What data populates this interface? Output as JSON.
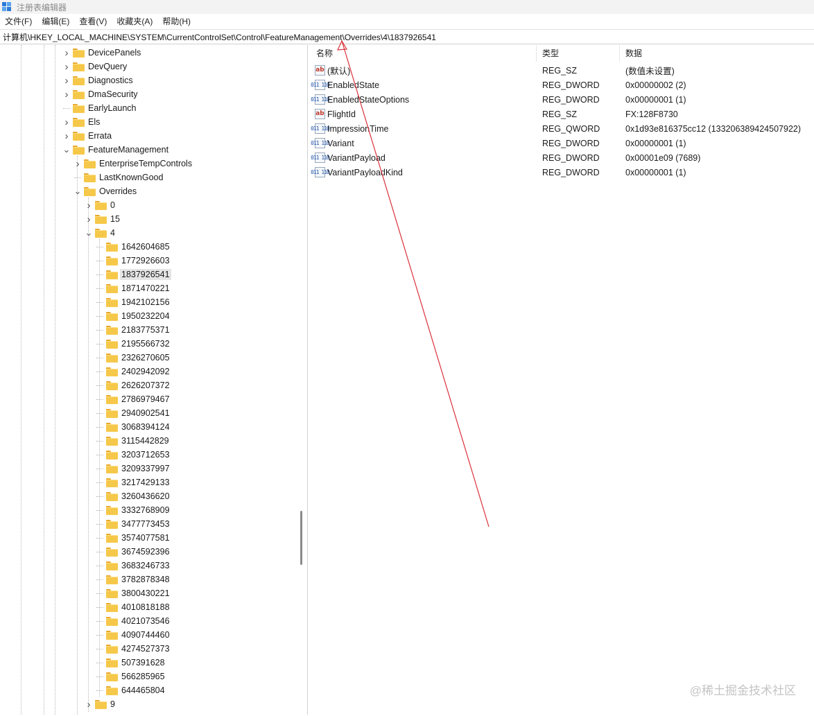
{
  "window": {
    "title": "注册表编辑器"
  },
  "menu": [
    "文件(F)",
    "编辑(E)",
    "查看(V)",
    "收藏夹(A)",
    "帮助(H)"
  ],
  "address": "计算机\\HKEY_LOCAL_MACHINE\\SYSTEM\\CurrentControlSet\\Control\\FeatureManagement\\Overrides\\4\\1837926541",
  "tree": [
    {
      "label": "DevicePanels",
      "level": 0,
      "expander": "collapsed"
    },
    {
      "label": "DevQuery",
      "level": 0,
      "expander": "collapsed"
    },
    {
      "label": "Diagnostics",
      "level": 0,
      "expander": "collapsed"
    },
    {
      "label": "DmaSecurity",
      "level": 0,
      "expander": "collapsed"
    },
    {
      "label": "EarlyLaunch",
      "level": 0,
      "expander": "none"
    },
    {
      "label": "Els",
      "level": 0,
      "expander": "collapsed"
    },
    {
      "label": "Errata",
      "level": 0,
      "expander": "collapsed"
    },
    {
      "label": "FeatureManagement",
      "level": 0,
      "expander": "expanded"
    },
    {
      "label": "EnterpriseTempControls",
      "level": 1,
      "expander": "collapsed"
    },
    {
      "label": "LastKnownGood",
      "level": 1,
      "expander": "none"
    },
    {
      "label": "Overrides",
      "level": 1,
      "expander": "expanded"
    },
    {
      "label": "0",
      "level": 2,
      "expander": "collapsed"
    },
    {
      "label": "15",
      "level": 2,
      "expander": "collapsed"
    },
    {
      "label": "4",
      "level": 2,
      "expander": "expanded"
    },
    {
      "label": "1642604685",
      "level": 3,
      "expander": "none"
    },
    {
      "label": "1772926603",
      "level": 3,
      "expander": "none"
    },
    {
      "label": "1837926541",
      "level": 3,
      "expander": "none",
      "selected": true
    },
    {
      "label": "1871470221",
      "level": 3,
      "expander": "none"
    },
    {
      "label": "1942102156",
      "level": 3,
      "expander": "none"
    },
    {
      "label": "1950232204",
      "level": 3,
      "expander": "none"
    },
    {
      "label": "2183775371",
      "level": 3,
      "expander": "none"
    },
    {
      "label": "2195566732",
      "level": 3,
      "expander": "none"
    },
    {
      "label": "2326270605",
      "level": 3,
      "expander": "none"
    },
    {
      "label": "2402942092",
      "level": 3,
      "expander": "none"
    },
    {
      "label": "2626207372",
      "level": 3,
      "expander": "none"
    },
    {
      "label": "2786979467",
      "level": 3,
      "expander": "none"
    },
    {
      "label": "2940902541",
      "level": 3,
      "expander": "none"
    },
    {
      "label": "3068394124",
      "level": 3,
      "expander": "none"
    },
    {
      "label": "3115442829",
      "level": 3,
      "expander": "none"
    },
    {
      "label": "3203712653",
      "level": 3,
      "expander": "none"
    },
    {
      "label": "3209337997",
      "level": 3,
      "expander": "none"
    },
    {
      "label": "3217429133",
      "level": 3,
      "expander": "none"
    },
    {
      "label": "3260436620",
      "level": 3,
      "expander": "none"
    },
    {
      "label": "3332768909",
      "level": 3,
      "expander": "none"
    },
    {
      "label": "3477773453",
      "level": 3,
      "expander": "none"
    },
    {
      "label": "3574077581",
      "level": 3,
      "expander": "none"
    },
    {
      "label": "3674592396",
      "level": 3,
      "expander": "none"
    },
    {
      "label": "3683246733",
      "level": 3,
      "expander": "none"
    },
    {
      "label": "3782878348",
      "level": 3,
      "expander": "none"
    },
    {
      "label": "3800430221",
      "level": 3,
      "expander": "none"
    },
    {
      "label": "4010818188",
      "level": 3,
      "expander": "none"
    },
    {
      "label": "4021073546",
      "level": 3,
      "expander": "none"
    },
    {
      "label": "4090744460",
      "level": 3,
      "expander": "none"
    },
    {
      "label": "4274527373",
      "level": 3,
      "expander": "none"
    },
    {
      "label": "507391628",
      "level": 3,
      "expander": "none"
    },
    {
      "label": "566285965",
      "level": 3,
      "expander": "none"
    },
    {
      "label": "644465804",
      "level": 3,
      "expander": "none"
    },
    {
      "label": "9",
      "level": 2,
      "expander": "collapsed"
    }
  ],
  "list": {
    "headers": {
      "name": "名称",
      "type": "类型",
      "data": "数据"
    },
    "rows": [
      {
        "icon": "string-value-icon",
        "kind": "sz",
        "name": "(默认)",
        "type": "REG_SZ",
        "data": "(数值未设置)"
      },
      {
        "icon": "binary-value-icon",
        "kind": "bin",
        "name": "EnabledState",
        "type": "REG_DWORD",
        "data": "0x00000002 (2)"
      },
      {
        "icon": "binary-value-icon",
        "kind": "bin",
        "name": "EnabledStateOptions",
        "type": "REG_DWORD",
        "data": "0x00000001 (1)"
      },
      {
        "icon": "string-value-icon",
        "kind": "sz",
        "name": "FlightId",
        "type": "REG_SZ",
        "data": "FX:128F8730"
      },
      {
        "icon": "binary-value-icon",
        "kind": "bin",
        "name": "ImpressionTime",
        "type": "REG_QWORD",
        "data": "0x1d93e816375cc12 (133206389424507922)"
      },
      {
        "icon": "binary-value-icon",
        "kind": "bin",
        "name": "Variant",
        "type": "REG_DWORD",
        "data": "0x00000001 (1)"
      },
      {
        "icon": "binary-value-icon",
        "kind": "bin",
        "name": "VariantPayload",
        "type": "REG_DWORD",
        "data": "0x00001e09 (7689)"
      },
      {
        "icon": "binary-value-icon",
        "kind": "bin",
        "name": "VariantPayloadKind",
        "type": "REG_DWORD",
        "data": "0x00000001 (1)"
      }
    ]
  },
  "annotation": {
    "color": "#d9313a"
  },
  "watermark": "@稀土掘金技术社区"
}
